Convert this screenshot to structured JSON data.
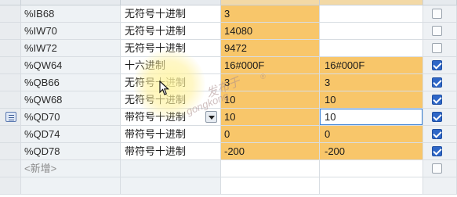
{
  "rows": [
    {
      "address": "%IB68",
      "format": "无符号十进制",
      "monitor": "3",
      "modify": "",
      "checked": false
    },
    {
      "address": "%IW70",
      "format": "无符号十进制",
      "monitor": "14080",
      "modify": "",
      "checked": false
    },
    {
      "address": "%IW72",
      "format": "无符号十进制",
      "monitor": "9472",
      "modify": "",
      "checked": false
    },
    {
      "address": "%QW64",
      "format": "十六进制",
      "monitor": "16#000F",
      "modify": "16#000F",
      "checked": true
    },
    {
      "address": "%QB66",
      "format": "无符号十进制",
      "monitor": "3",
      "modify": "3",
      "checked": true
    },
    {
      "address": "%QW68",
      "format": "无符号十进制",
      "monitor": "10",
      "modify": "10",
      "checked": true
    },
    {
      "address": "%QD70",
      "format": "带符号十进制",
      "monitor": "10",
      "modify": "10",
      "checked": true
    },
    {
      "address": "%QD74",
      "format": "带符号十进制",
      "monitor": "0",
      "modify": "0",
      "checked": true
    },
    {
      "address": "%QD78",
      "format": "带符号十进制",
      "monitor": "-200",
      "modify": "-200",
      "checked": true
    }
  ],
  "new_row": {
    "label": "<新增>",
    "checked": false
  },
  "watermark": {
    "line1": "发布于",
    "line2": "gongkong",
    "mark": "®"
  },
  "colors": {
    "accent_orange": "#f8c66a",
    "checkbox_blue": "#2f67c7",
    "focus_border": "#3b82d6"
  },
  "icons": {
    "row_marker": "list-row-icon",
    "dropdown": "chevron-down-icon",
    "cursor": "mouse-pointer-icon"
  }
}
